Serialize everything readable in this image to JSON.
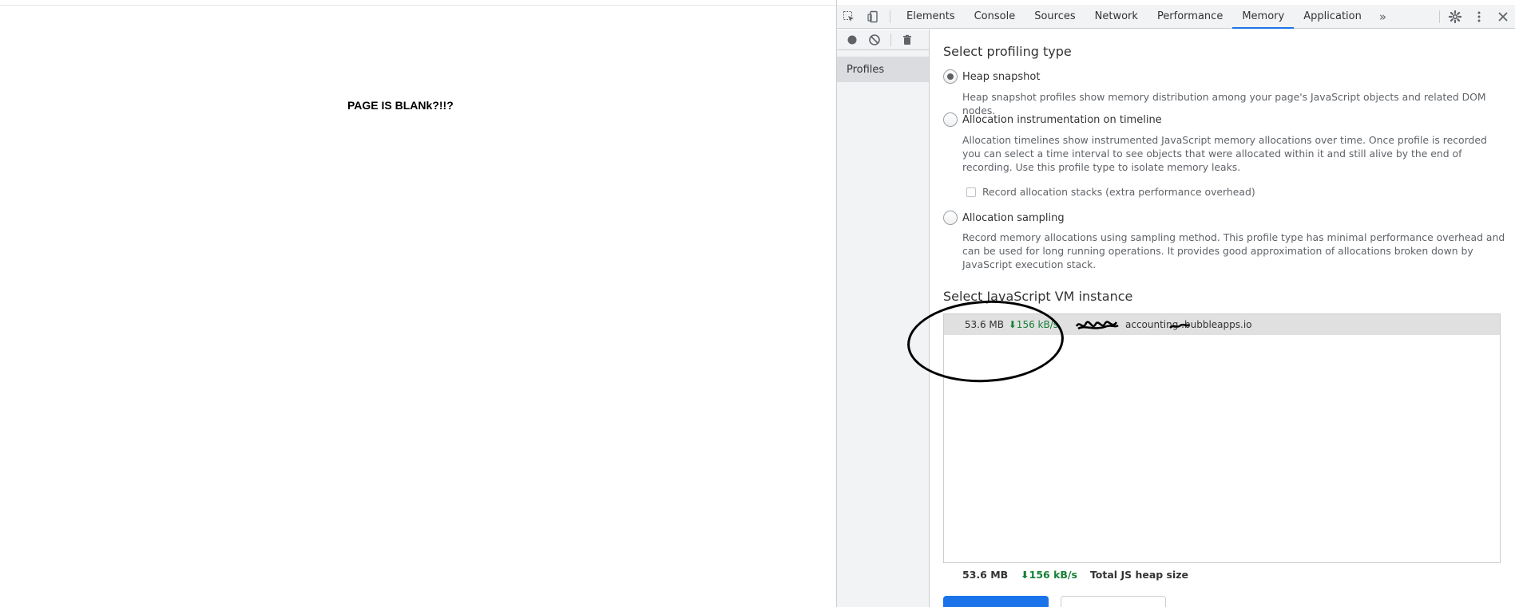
{
  "page": {
    "text": "PAGE IS BLANk?!!?"
  },
  "devtools": {
    "tabs": [
      "Elements",
      "Console",
      "Sources",
      "Network",
      "Performance",
      "Memory",
      "Application"
    ],
    "active_tab": "Memory",
    "more_tabs": "»",
    "sidebar": {
      "item": "Profiles"
    },
    "profiling": {
      "title": "Select profiling type",
      "options": [
        {
          "label": "Heap snapshot",
          "description": "Heap snapshot profiles show memory distribution among your page's JavaScript objects and related DOM nodes.",
          "checked": true
        },
        {
          "label": "Allocation instrumentation on timeline",
          "description": "Allocation timelines show instrumented JavaScript memory allocations over time. Once profile is recorded you can select a time interval to see objects that were allocated within it and still alive by the end of recording. Use this profile type to isolate memory leaks.",
          "checked": false,
          "checkbox_label": "Record allocation stacks (extra performance overhead)"
        },
        {
          "label": "Allocation sampling",
          "description": "Record memory allocations using sampling method. This profile type has minimal performance overhead and can be used for long running operations. It provides good approximation of allocations broken down by JavaScript execution stack.",
          "checked": false
        }
      ]
    },
    "vm": {
      "title": "Select JavaScript VM instance",
      "row": {
        "size": "53.6 MB",
        "rate": "⬇156 kB/s",
        "url": "accounting   .bubbleapps.io"
      }
    },
    "summary": {
      "size": "53.6 MB",
      "rate": "⬇156 kB/s",
      "label": "Total JS heap size"
    }
  },
  "colors": {
    "accent": "#1a73e8",
    "rate_green": "#188038"
  }
}
